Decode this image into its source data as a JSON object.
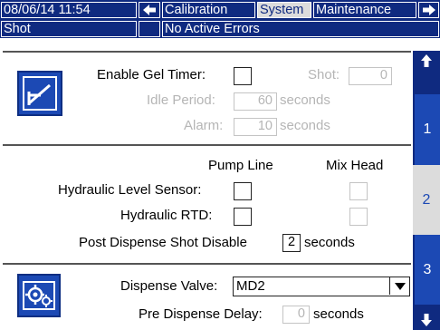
{
  "topbar": {
    "datetime": "08/06/14 11:54",
    "tabs": [
      {
        "label": "Calibration",
        "active": false
      },
      {
        "label": "System",
        "active": true
      },
      {
        "label": "Maintenance",
        "active": false
      }
    ]
  },
  "status": {
    "mode": "Shot",
    "message": "No Active Errors"
  },
  "gel_timer": {
    "enable_label": "Enable Gel Timer:",
    "shot_label": "Shot:",
    "shot_value": "0",
    "idle_label": "Idle Period:",
    "idle_value": "60",
    "idle_unit": "seconds",
    "alarm_label": "Alarm:",
    "alarm_value": "10",
    "alarm_unit": "seconds"
  },
  "hydraulic": {
    "col_pump": "Pump Line",
    "col_mix": "Mix Head",
    "level_sensor_label": "Hydraulic Level Sensor:",
    "rtd_label": "Hydraulic RTD:",
    "post_dispense_label": "Post Dispense Shot Disable",
    "post_dispense_value": "2",
    "post_dispense_unit": "seconds"
  },
  "dispense": {
    "valve_label": "Dispense Valve:",
    "valve_value": "MD2",
    "pre_delay_label": "Pre Dispense Delay:",
    "pre_delay_value": "0",
    "pre_delay_unit": "seconds"
  },
  "pages": {
    "page1": "1",
    "page2": "2",
    "page3": "3",
    "active": "2"
  },
  "icons": {
    "section1": "enable-timer-icon",
    "section3": "valve-gears-icon",
    "nav_left": "arrow-left-icon",
    "nav_right": "arrow-right-icon",
    "page_up": "arrow-up-icon",
    "page_down": "arrow-down-icon"
  },
  "colors": {
    "header_blue": "#0f2a80",
    "accent_blue": "#1c49b4",
    "active_tab": "#dcdcdc"
  }
}
